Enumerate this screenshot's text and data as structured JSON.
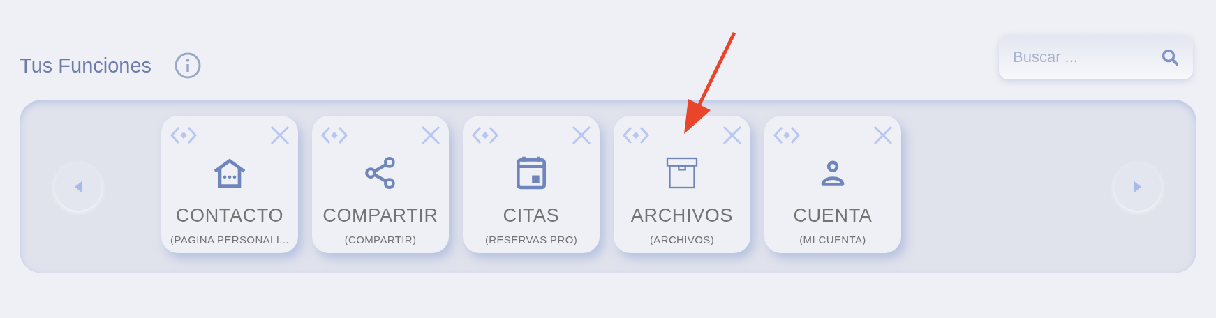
{
  "header": {
    "title": "Tus Funciones"
  },
  "search": {
    "placeholder": "Buscar ..."
  },
  "cards": [
    {
      "title": "CONTACTO",
      "subtitle": "(PAGINA PERSONALI..."
    },
    {
      "title": "COMPARTIR",
      "subtitle": "(COMPARTIR)"
    },
    {
      "title": "CITAS",
      "subtitle": "(RESERVAS PRO)"
    },
    {
      "title": "ARCHIVOS",
      "subtitle": "(ARCHIVOS)"
    },
    {
      "title": "CUENTA",
      "subtitle": "(MI CUENTA)"
    }
  ]
}
